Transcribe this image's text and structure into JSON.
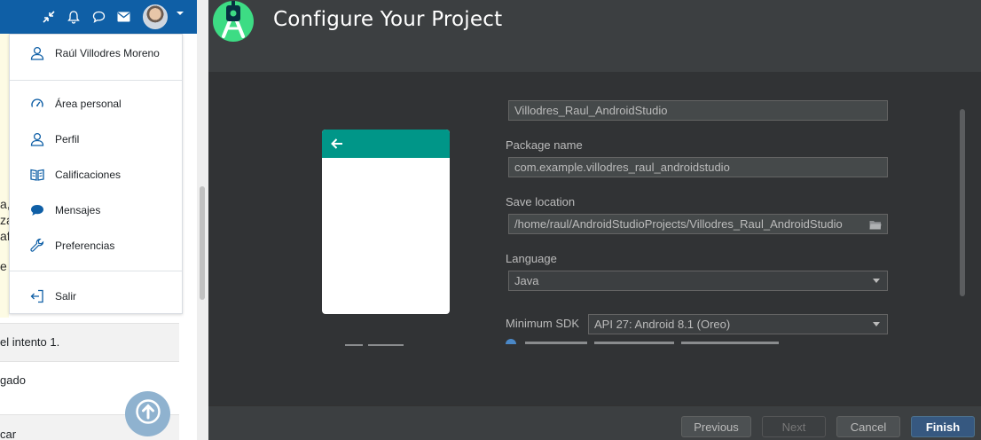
{
  "moodle": {
    "user_menu": {
      "username": "Raúl Villodres Moreno",
      "items": [
        {
          "label": "Área personal",
          "icon": "dashboard-icon"
        },
        {
          "label": "Perfil",
          "icon": "user-icon"
        },
        {
          "label": "Calificaciones",
          "icon": "grades-icon"
        },
        {
          "label": "Mensajes",
          "icon": "message-icon"
        },
        {
          "label": "Preferencias",
          "icon": "wrench-icon"
        }
      ],
      "logout": "Salir"
    },
    "background_fragments": [
      "a,",
      "za",
      "af",
      "e"
    ],
    "rows": [
      "el intento 1.",
      "gado",
      "car"
    ]
  },
  "android_studio": {
    "title": "Configure Your Project",
    "name_value": "Villodres_Raul_AndroidStudio",
    "package_label": "Package name",
    "package_value": "com.example.villodres_raul_androidstudio",
    "save_label": "Save location",
    "save_value": "/home/raul/AndroidStudioProjects/Villodres_Raul_AndroidStudio",
    "language_label": "Language",
    "language_value": "Java",
    "min_sdk_label": "Minimum SDK",
    "min_sdk_value": "API 27: Android 8.1 (Oreo)",
    "buttons": {
      "previous": "Previous",
      "next": "Next",
      "cancel": "Cancel",
      "finish": "Finish"
    }
  },
  "colors": {
    "moodle_blue": "#0f5fa6",
    "as_background": "#3c3f41",
    "as_panel": "#313335",
    "preview_toolbar": "#009688",
    "finish_button": "#365880"
  }
}
